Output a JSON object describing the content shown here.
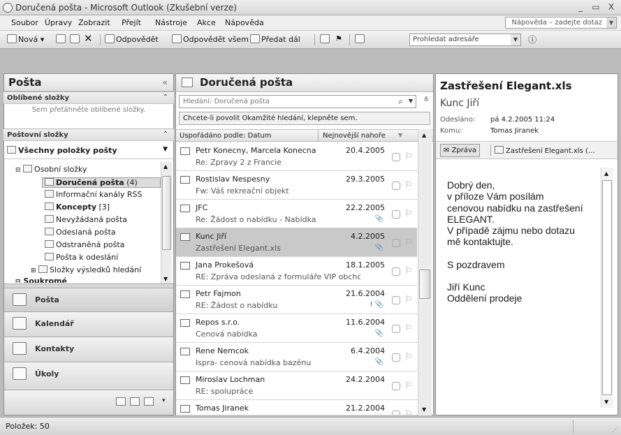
{
  "window": {
    "title": "Doručená pošta - Microsoft Outlook (Zkušební verze)",
    "minimize": "_",
    "maximize": "▭",
    "close": "X"
  },
  "menu": {
    "items": [
      "Soubor",
      "Úpravy",
      "Zobrazit",
      "Přejít",
      "Nástroje",
      "Akce",
      "Nápověda"
    ],
    "help_placeholder": "Nápověda – zadejte dotaz"
  },
  "toolbar": {
    "new": "Nová",
    "reply": "Odpovědět",
    "reply_all": "Odpovědět všem",
    "forward": "Předat dál",
    "search_address": "Prohledat adresáře"
  },
  "nav": {
    "title": "Pošta",
    "collapse": "«",
    "favorites_header": "Oblíbené složky",
    "favorites_hint": "Sem přetáhněte oblíbené složky.",
    "mail_folders_header": "Poštovní složky",
    "all_mail": "Všechny položky pošty",
    "tree": [
      {
        "label": "Osobní složky",
        "count": ""
      },
      {
        "label": "Doručená pošta",
        "count": "(4)"
      },
      {
        "label": "Informační kanály RSS",
        "count": ""
      },
      {
        "label": "Koncepty",
        "count": "[3]"
      },
      {
        "label": "Nevyžádaná pošta",
        "count": ""
      },
      {
        "label": "Odeslaná pošta",
        "count": ""
      },
      {
        "label": "Odstraněná pošta",
        "count": ""
      },
      {
        "label": "Pošta k odeslání",
        "count": ""
      },
      {
        "label": "Složky výsledků hledání",
        "count": ""
      },
      {
        "label": "Soukromé",
        "count": ""
      }
    ],
    "buttons": [
      "Pošta",
      "Kalendář",
      "Kontakty",
      "Úkoly"
    ]
  },
  "list": {
    "title": "Doručená pošta",
    "search_placeholder": "Hledání: Doručená pošta",
    "instant_search_hint": "Chcete-li povolit Okamžité hledání, klepněte sem.",
    "sort_by": "Uspořádáno podle: Datum",
    "sort_order": "Nejnovější nahoře",
    "messages": [
      {
        "from": "Petr Konecny, Marcela Konecna",
        "subject": "Re: Zpravy 2 z Francie",
        "date": "20.4.2005",
        "meta": ""
      },
      {
        "from": "Rostislav Nespesny",
        "subject": "Fw:  Váš rekreační objekt",
        "date": "29.3.2005",
        "meta": ""
      },
      {
        "from": "JFC",
        "subject": "Re: Žádost o nabídku - Nabídka",
        "date": "22.2.2005",
        "meta": "📎"
      },
      {
        "from": "Kunc Jiří",
        "subject": "Zastřešení Elegant.xls",
        "date": "4.2.2005",
        "meta": "📎"
      },
      {
        "from": "Jana Prokešová",
        "subject": "RE: Zpráva odeslaná z formuláře VIP obchodu",
        "date": "18.1.2005",
        "meta": ""
      },
      {
        "from": "Petr Fajmon",
        "subject": "RE: Žádost o nabídku",
        "date": "21.6.2004",
        "meta": "! 📎"
      },
      {
        "from": "Repos s.r.o.",
        "subject": "Cenová nabídka",
        "date": "11.6.2004",
        "meta": "📎"
      },
      {
        "from": "Rene Nemcok",
        "subject": "Ispra- cenová nabídka bazénu",
        "date": "6.4.2004",
        "meta": "📎"
      },
      {
        "from": "Miroslav Lochman",
        "subject": "RE: spolupráce",
        "date": "24.2.2004",
        "meta": ""
      },
      {
        "from": "Tomas Jiranek",
        "subject": "",
        "date": "21.2.2004",
        "meta": ""
      }
    ]
  },
  "reading": {
    "subject": "Zastřešení Elegant.xls",
    "sender": "Kunc Jiří",
    "sent_label": "Odesláno:",
    "sent_value": "pá 4.2.2005 11:24",
    "to_label": "Komu:",
    "to_value": "Tomas Jiranek",
    "tab_message": "Zpráva",
    "tab_attachment": "Zastřešení Elegant.xls (...",
    "body": [
      "Dobrý den,",
      "v příloze Vám posílám",
      "cenovou nabídku na zastřešení",
      "ELEGANT.",
      "V případě zájmu nebo dotazu",
      "mě kontaktujte.",
      "",
      "S pozdravem",
      "",
      "Jiří Kunc",
      "Oddělení prodeje"
    ]
  },
  "status": {
    "items_count": "Položek: 50"
  }
}
